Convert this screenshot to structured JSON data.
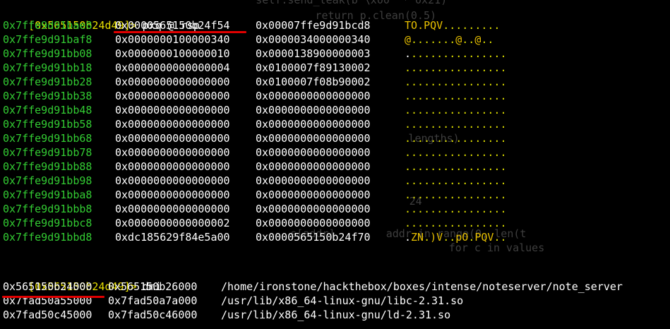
{
  "terminal": {
    "background_code": [
      "        self.send_leak(b'\\x00' * 0x21)",
      "              return p.clean(0.5)",
      "              lengths)",
      "                     24",
      "         s[addr]        addr in range(0, len(t",
      "                         for c in values"
    ],
    "prompt1": "[0x565150b24d49]>",
    "command1": "pxq @ rsp",
    "pxq_rows": [
      {
        "addr": "0x7ffe9d91bae8",
        "v1": "0x0000565150b24f54",
        "v2": "0x00007ffe9d91bcd8",
        "ascii": [
          [
            "T",
            "y"
          ],
          [
            "O",
            "y"
          ],
          [
            ".",
            "y"
          ],
          [
            "P",
            "y"
          ],
          [
            "Q",
            "y"
          ],
          [
            "V",
            "y"
          ],
          [
            ".........",
            "d"
          ]
        ]
      },
      {
        "addr": "0x7ffe9d91baf8",
        "v1": "0x0000000100000340",
        "v2": "0x0000034000000340",
        "ascii": [
          [
            "@",
            "y"
          ],
          [
            ".......",
            "d"
          ],
          [
            "@",
            "y"
          ],
          [
            "..",
            "d"
          ],
          [
            "@",
            "y"
          ],
          [
            "..",
            "d"
          ]
        ]
      },
      {
        "addr": "0x7ffe9d91bb08",
        "v1": "0x0000000100000010",
        "v2": "0x0000138900000003",
        "ascii": [
          [
            ".",
            "w"
          ],
          [
            "...............",
            "d"
          ]
        ]
      },
      {
        "addr": "0x7ffe9d91bb18",
        "v1": "0x0000000000000004",
        "v2": "0x0100007f89130002",
        "ascii": [
          [
            "................",
            "d"
          ]
        ]
      },
      {
        "addr": "0x7ffe9d91bb28",
        "v1": "0x0000000000000000",
        "v2": "0x0100007f08b90002",
        "ascii": [
          [
            "................",
            "d"
          ]
        ]
      },
      {
        "addr": "0x7ffe9d91bb38",
        "v1": "0x0000000000000000",
        "v2": "0x0000000000000000",
        "ascii": [
          [
            "................",
            "d"
          ]
        ]
      },
      {
        "addr": "0x7ffe9d91bb48",
        "v1": "0x0000000000000000",
        "v2": "0x0000000000000000",
        "ascii": [
          [
            "................",
            "d"
          ]
        ]
      },
      {
        "addr": "0x7ffe9d91bb58",
        "v1": "0x0000000000000000",
        "v2": "0x0000000000000000",
        "ascii": [
          [
            "................",
            "d"
          ]
        ]
      },
      {
        "addr": "0x7ffe9d91bb68",
        "v1": "0x0000000000000000",
        "v2": "0x0000000000000000",
        "ascii": [
          [
            "................",
            "d"
          ]
        ]
      },
      {
        "addr": "0x7ffe9d91bb78",
        "v1": "0x0000000000000000",
        "v2": "0x0000000000000000",
        "ascii": [
          [
            "................",
            "d"
          ]
        ]
      },
      {
        "addr": "0x7ffe9d91bb88",
        "v1": "0x0000000000000000",
        "v2": "0x0000000000000000",
        "ascii": [
          [
            "................",
            "d"
          ]
        ]
      },
      {
        "addr": "0x7ffe9d91bb98",
        "v1": "0x0000000000000000",
        "v2": "0x0000000000000000",
        "ascii": [
          [
            "................",
            "d"
          ]
        ]
      },
      {
        "addr": "0x7ffe9d91bba8",
        "v1": "0x0000000000000000",
        "v2": "0x0000000000000000",
        "ascii": [
          [
            "................",
            "d"
          ]
        ]
      },
      {
        "addr": "0x7ffe9d91bbb8",
        "v1": "0x0000000000000000",
        "v2": "0x0000000000000000",
        "ascii": [
          [
            "................",
            "d"
          ]
        ]
      },
      {
        "addr": "0x7ffe9d91bbc8",
        "v1": "0x0000000000000002",
        "v2": "0x0000000000000000",
        "ascii": [
          [
            "................",
            "d"
          ]
        ]
      },
      {
        "addr": "0x7ffe9d91bbd8",
        "v1": "0xdc185629f84e5a00",
        "v2": "0x0000565150b24f70",
        "ascii": [
          [
            ".",
            "w"
          ],
          [
            "ZN",
            "y"
          ],
          [
            ".",
            "d"
          ],
          [
            ")",
            "y"
          ],
          [
            "V",
            "y"
          ],
          [
            "..",
            "d"
          ],
          [
            "pO",
            "y"
          ],
          [
            ".",
            "d"
          ],
          [
            "PQV",
            "y"
          ],
          [
            "..",
            "d"
          ]
        ]
      }
    ],
    "prompt2": "[0x565150b24d49]>",
    "command2": "dmi",
    "dmi_rows": [
      {
        "start": "0x565150b24000",
        "end": "0x565150b26000",
        "path": "/home/ironstone/hackthebox/boxes/intense/noteserver/note_server"
      },
      {
        "start": "0x7fad50a55000",
        "end": "0x7fad50a7a000",
        "path": "/usr/lib/x86_64-linux-gnu/libc-2.31.so"
      },
      {
        "start": "0x7fad50c45000",
        "end": "0x7fad50c46000",
        "path": "/usr/lib/x86_64-linux-gnu/ld-2.31.so"
      }
    ],
    "colors": {
      "background": "#000000",
      "prompt": "#e8e000",
      "address": "#33cc33",
      "value": "#ffffff",
      "ascii_printable": "#e8c000",
      "ascii_dot": "#dede00",
      "underline": "#e00000"
    }
  }
}
